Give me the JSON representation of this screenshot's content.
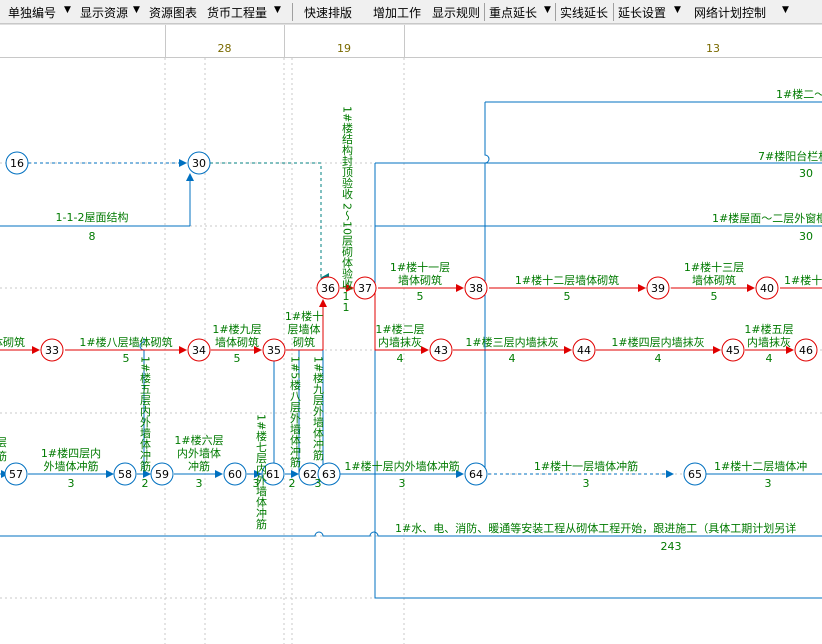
{
  "toolbar": {
    "items": [
      "单独编号",
      "显示资源",
      "资源图表",
      "货币工程量",
      "快速排版",
      "增加工作",
      "显示规则",
      "重点延长",
      "实线延长",
      "延长设置",
      "网络计划控制"
    ]
  },
  "timescale": {
    "cells": [
      "28",
      "19",
      "13"
    ]
  },
  "nodes": {
    "n16": "16",
    "n30": "30",
    "n36": "36",
    "n37": "37",
    "n38": "38",
    "n39": "39",
    "n40": "40",
    "n33": "33",
    "n34": "34",
    "n35": "35",
    "n43": "43",
    "n44": "44",
    "n45": "45",
    "n46": "46",
    "n57": "57",
    "n58": "58",
    "n59": "59",
    "n60": "60",
    "n61": "61",
    "n62": "62",
    "n63": "63",
    "n64": "64",
    "n65": "65"
  },
  "labels": {
    "top_right": "1#楼二～",
    "balcony": "7#楼阳台栏杆",
    "balcony_d": "30",
    "roof_struct": "1-1-2屋面结构",
    "roof_struct_d": "8",
    "roof_windows": "1#楼屋面～二层外窗框",
    "roof_windows_d": "30",
    "floor11": "1#楼十一层",
    "floor11b": "墙体砌筑",
    "floor11_d": "5",
    "floor12": "1#楼十二层墙体砌筑",
    "floor12_d": "5",
    "floor13": "1#楼十三层",
    "floor13b": "墙体砌筑",
    "floor13_d": "5",
    "floor14": "1#楼十",
    "masonry_frag": "体砌筑",
    "floor8": "1#楼八层墙体砌筑",
    "floor8_d": "5",
    "floor9": "1#楼九层",
    "floor9b": "墙体砌筑",
    "floor9_d": "5",
    "floor10a": "1#楼十",
    "floor10b": "层墙体",
    "floor10c": "砌筑",
    "floor10_d": "1",
    "plaster2": "1#楼二层",
    "plaster2b": "内墙抹灰",
    "plaster2_d": "4",
    "plaster3": "1#楼三层内墙抹灰",
    "plaster3_d": "4",
    "plaster4": "1#楼四层内墙抹灰",
    "plaster4_d": "4",
    "plaster5": "1#楼五层",
    "plaster5b": "内墙抹灰",
    "plaster5_d": "4",
    "frag_left1": "层",
    "frag_left2": "筋",
    "rinse4a": "1#楼四层内",
    "rinse4b": "外墙体冲筋",
    "rinse4_d": "3",
    "rinse6a": "1#楼六层",
    "rinse6b": "内外墙体",
    "rinse6c": "冲筋",
    "rinse6_d": "3",
    "rinse10": "1#楼十层内外墙体冲筋",
    "rinse10_d": "3",
    "rinse11": "1#楼十一层墙体冲筋",
    "rinse11_d": "3",
    "rinse12": "1#楼十二层墙体冲",
    "rinse12_d": "3",
    "mep": "1#水、电、消防、暖通等安装工程从砌体工程开始，跟进施工（具体工期计划另详",
    "mep_d": "243",
    "v_roof_accept": "1#楼结构封顶验收",
    "v_roof_accept_d": "1",
    "v_masonry_accept": "2～10层砌体验收",
    "v_rinse5": "1#楼五层内外墙体冲筋",
    "v_rinse5_d": "2",
    "v_rinse7": "1#楼七层内外墙体冲筋",
    "v_rinse7_d": "3",
    "v_rinse8": "1#5楼八层外墙体冲筋",
    "v_rinse8_d": "2",
    "v_rinse9": "1#楼九层外墙体冲筋",
    "v_rinse9_d": "3"
  },
  "colors": {
    "critical": "#e00000",
    "normal": "#0070c0",
    "text": "#007a00",
    "node_fill": "#ffffff",
    "dashed": "#0070c0"
  }
}
